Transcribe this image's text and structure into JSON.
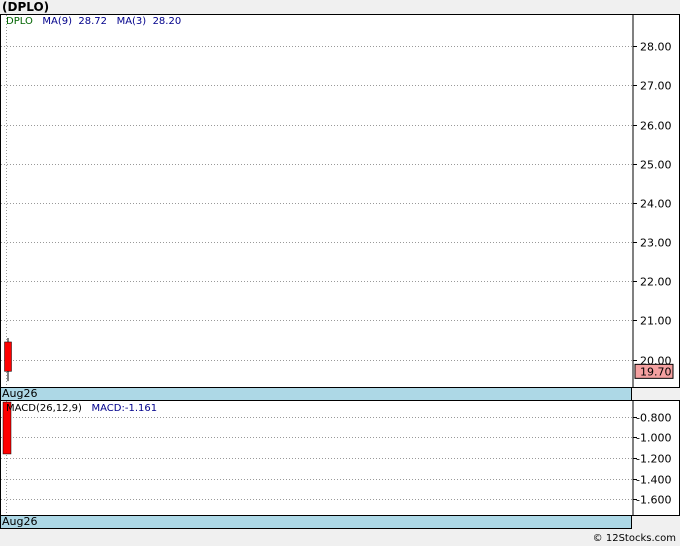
{
  "header": {
    "title": "(DPLO)"
  },
  "price_legend": {
    "ticker": "DPLO",
    "ma9_label": "MA(9)",
    "ma9_value": "28.72",
    "ma3_label": "MA(3)",
    "ma3_value": "28.20"
  },
  "macd_legend": {
    "label": "MACD(26,12,9)",
    "value_label": "MACD:-1.161"
  },
  "date_label": "Aug26",
  "current_price_badge": "19.70",
  "credit": "© 12Stocks.com",
  "colors": {
    "candle": "#ff0000",
    "datebar": "#add8e6",
    "badge": "#f4a0a0",
    "legend_text": "#00008b"
  },
  "chart_data": [
    {
      "type": "candlestick",
      "title": "(DPLO)",
      "categories": [
        "Aug26"
      ],
      "candles": [
        {
          "x": "Aug26",
          "open": 20.45,
          "close": 19.7,
          "high": 20.55,
          "low": 19.45
        }
      ],
      "ylim": [
        19.3,
        28.8
      ],
      "yticks": [
        "20.00",
        "21.00",
        "22.00",
        "23.00",
        "24.00",
        "25.00",
        "26.00",
        "27.00",
        "28.00"
      ],
      "yticks_values": [
        20,
        21,
        22,
        23,
        24,
        25,
        26,
        27,
        28
      ],
      "grid": true,
      "last_price": 19.7
    },
    {
      "type": "bar",
      "title": "MACD(26,12,9)",
      "categories": [
        "Aug26"
      ],
      "values": [
        -1.161
      ],
      "ylim": [
        -1.75,
        -0.65
      ],
      "yticks": [
        "-0.800",
        "-1.000",
        "-1.200",
        "-1.400",
        "-1.600"
      ],
      "yticks_values": [
        -0.8,
        -1.0,
        -1.2,
        -1.4,
        -1.6
      ],
      "grid": true
    }
  ]
}
